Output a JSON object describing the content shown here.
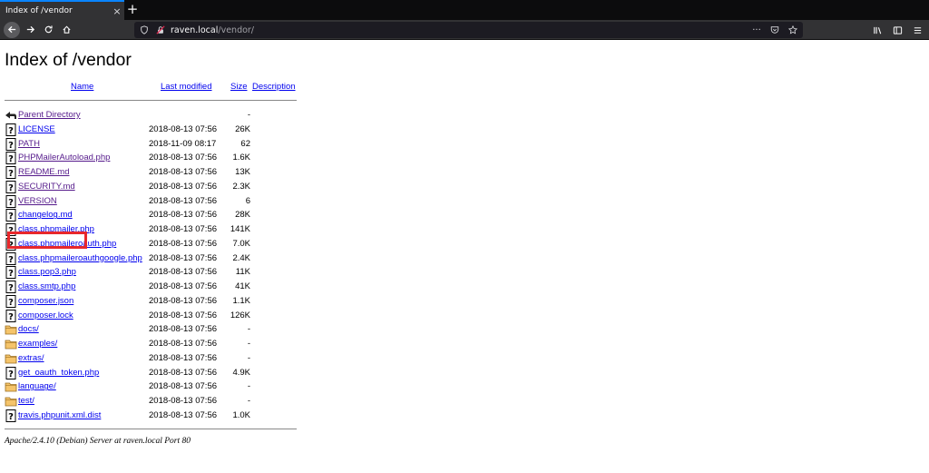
{
  "browser": {
    "tab_title": "Index of /vendor",
    "tab_close": "×",
    "new_tab": "+",
    "url_host": "raven.local",
    "url_path": "/vendor/",
    "url_menu": "···"
  },
  "page": {
    "title": "Index of /vendor",
    "headers": {
      "name": "Name",
      "last_modified": "Last modified",
      "size": "Size",
      "description": "Description"
    },
    "entries": [
      {
        "icon": "back-icon",
        "name": "Parent Directory",
        "date": "",
        "size": "-",
        "visited": true
      },
      {
        "icon": "unknown-file-icon",
        "name": "LICENSE",
        "date": "2018-08-13 07:56",
        "size": "26K",
        "visited": false
      },
      {
        "icon": "unknown-file-icon",
        "name": "PATH",
        "date": "2018-11-09 08:17",
        "size": "62",
        "visited": true
      },
      {
        "icon": "unknown-file-icon",
        "name": "PHPMailerAutoload.php",
        "date": "2018-08-13 07:56",
        "size": "1.6K",
        "visited": true
      },
      {
        "icon": "unknown-file-icon",
        "name": "README.md",
        "date": "2018-08-13 07:56",
        "size": "13K",
        "visited": true
      },
      {
        "icon": "unknown-file-icon",
        "name": "SECURITY.md",
        "date": "2018-08-13 07:56",
        "size": "2.3K",
        "visited": true
      },
      {
        "icon": "unknown-file-icon",
        "name": "VERSION",
        "date": "2018-08-13 07:56",
        "size": "6",
        "visited": true
      },
      {
        "icon": "unknown-file-icon",
        "name": "changelog.md",
        "date": "2018-08-13 07:56",
        "size": "28K",
        "visited": false
      },
      {
        "icon": "unknown-file-icon",
        "name": "class.phpmailer.php",
        "date": "2018-08-13 07:56",
        "size": "141K",
        "visited": false
      },
      {
        "icon": "unknown-file-icon",
        "name": "class.phpmaileroauth.php",
        "date": "2018-08-13 07:56",
        "size": "7.0K",
        "visited": false
      },
      {
        "icon": "unknown-file-icon",
        "name": "class.phpmaileroauthgoogle.php",
        "date": "2018-08-13 07:56",
        "size": "2.4K",
        "visited": false
      },
      {
        "icon": "unknown-file-icon",
        "name": "class.pop3.php",
        "date": "2018-08-13 07:56",
        "size": "11K",
        "visited": false
      },
      {
        "icon": "unknown-file-icon",
        "name": "class.smtp.php",
        "date": "2018-08-13 07:56",
        "size": "41K",
        "visited": false
      },
      {
        "icon": "unknown-file-icon",
        "name": "composer.json",
        "date": "2018-08-13 07:56",
        "size": "1.1K",
        "visited": false
      },
      {
        "icon": "unknown-file-icon",
        "name": "composer.lock",
        "date": "2018-08-13 07:56",
        "size": "126K",
        "visited": false
      },
      {
        "icon": "folder-icon",
        "name": "docs/",
        "date": "2018-08-13 07:56",
        "size": "-",
        "visited": false
      },
      {
        "icon": "folder-icon",
        "name": "examples/",
        "date": "2018-08-13 07:56",
        "size": "-",
        "visited": false
      },
      {
        "icon": "folder-icon",
        "name": "extras/",
        "date": "2018-08-13 07:56",
        "size": "-",
        "visited": false
      },
      {
        "icon": "unknown-file-icon",
        "name": "get_oauth_token.php",
        "date": "2018-08-13 07:56",
        "size": "4.9K",
        "visited": false
      },
      {
        "icon": "folder-icon",
        "name": "language/",
        "date": "2018-08-13 07:56",
        "size": "-",
        "visited": false
      },
      {
        "icon": "folder-icon",
        "name": "test/",
        "date": "2018-08-13 07:56",
        "size": "-",
        "visited": false
      },
      {
        "icon": "unknown-file-icon",
        "name": "travis.phpunit.xml.dist",
        "date": "2018-08-13 07:56",
        "size": "1.0K",
        "visited": false
      }
    ],
    "footer": "Apache/2.4.10 (Debian) Server at raven.local Port 80"
  },
  "colors": {
    "link": "#0000ee",
    "visited": "#551a8b",
    "highlight": "#e8272b",
    "tabbar": "#0c0c0d",
    "toolbar": "#323234",
    "urlbar": "#1c1b22"
  }
}
